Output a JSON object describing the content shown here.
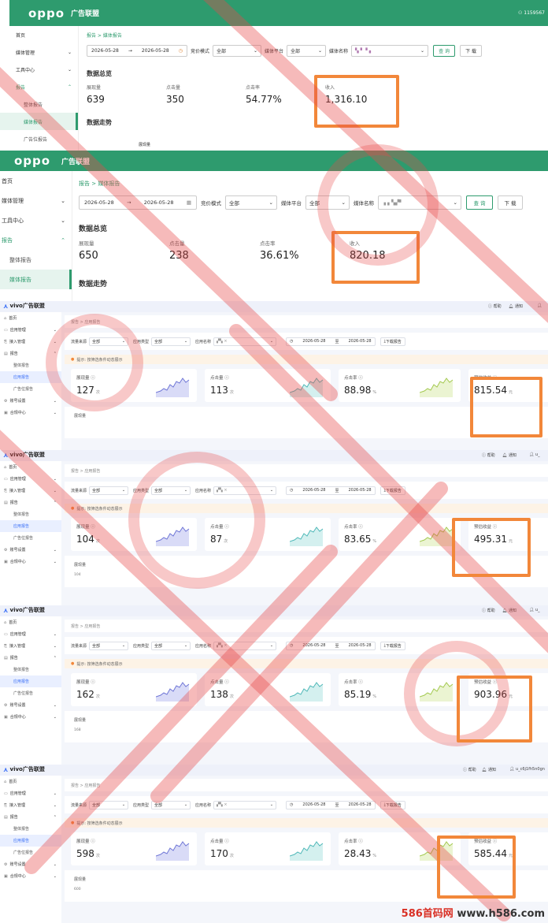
{
  "oppo_1": {
    "brand": "oppo",
    "brand_sub": "广告联盟",
    "user_id": "1159567",
    "sidebar": [
      {
        "label": "首页",
        "chevron": ""
      },
      {
        "label": "媒体管理",
        "chevron": "⌄"
      },
      {
        "label": "工具中心",
        "chevron": "⌄"
      },
      {
        "label": "报告",
        "chevron": "⌃"
      },
      {
        "label": "整体报告",
        "chevron": ""
      },
      {
        "label": "媒体报告",
        "chevron": ""
      },
      {
        "label": "广告位报告",
        "chevron": ""
      }
    ],
    "breadcrumb": "报告  >  媒体报告",
    "date_start": "2026-05-28",
    "date_end": "2026-05-28",
    "bid_mode_label": "竞价模式",
    "bid_mode_value": "全部",
    "platform_label": "媒体平台",
    "platform_value": "全部",
    "media_name_label": "媒体名称",
    "query_button": "查 询",
    "download_button": "下 载",
    "overview_title": "数据总览",
    "trend_title": "数据走势",
    "trend_sub": "展现量",
    "metrics": [
      {
        "label": "展现量",
        "value": "639"
      },
      {
        "label": "点击量",
        "value": "350"
      },
      {
        "label": "点击率",
        "value": "54.77%"
      },
      {
        "label": "收入",
        "value": "1,316.10"
      }
    ]
  },
  "oppo_2": {
    "brand": "oppo",
    "brand_sub": "广告联盟",
    "sidebar": [
      {
        "label": "首页",
        "chevron": ""
      },
      {
        "label": "媒体管理",
        "chevron": "⌄"
      },
      {
        "label": "工具中心",
        "chevron": "⌄"
      },
      {
        "label": "报告",
        "chevron": "⌃"
      },
      {
        "label": "整体报告",
        "chevron": ""
      },
      {
        "label": "媒体报告",
        "chevron": ""
      }
    ],
    "breadcrumb": "报告  >  媒体报告",
    "date_start": "2026-05-28",
    "date_end": "2026-05-28",
    "bid_mode_label": "竞价模式",
    "bid_mode_value": "全部",
    "platform_label": "媒体平台",
    "platform_value": "全部",
    "media_name_label": "媒体名称",
    "query_button": "查 询",
    "download_button": "下 载",
    "overview_title": "数据总览",
    "trend_title": "数据走势",
    "metrics": [
      {
        "label": "展现量",
        "value": "650"
      },
      {
        "label": "点击量",
        "value": "238"
      },
      {
        "label": "点击率",
        "value": "36.61%"
      },
      {
        "label": "收入",
        "value": "820.18"
      }
    ]
  },
  "vivo_common": {
    "brand": "vivo广告联盟",
    "help": "帮助",
    "notice": "通知",
    "sidebar": [
      {
        "icon": "⌂",
        "label": "首页",
        "chevron": "",
        "type": "top"
      },
      {
        "icon": "▭",
        "label": "应用管理",
        "chevron": "⌄",
        "type": "top"
      },
      {
        "icon": "⎘",
        "label": "接入管理",
        "chevron": "⌄",
        "type": "top"
      },
      {
        "icon": "▤",
        "label": "报告",
        "chevron": "⌃",
        "type": "top"
      },
      {
        "icon": "",
        "label": "整体报告",
        "chevron": "",
        "type": "sub"
      },
      {
        "icon": "",
        "label": "应用报告",
        "chevron": "",
        "type": "active"
      },
      {
        "icon": "",
        "label": "广告位报告",
        "chevron": "",
        "type": "sub"
      },
      {
        "icon": "⚙",
        "label": "账号设置",
        "chevron": "⌄",
        "type": "top"
      },
      {
        "icon": "▣",
        "label": "合规中心",
        "chevron": "⌄",
        "type": "top"
      }
    ],
    "breadcrumb": "报告  >  应用报告",
    "traffic_label": "流量来源",
    "app_type_label": "应用类型",
    "app_name_label": "应用名称",
    "select_all": "全部",
    "date_start": "2026-05-28",
    "date_sep": "至",
    "date_end": "2026-05-28",
    "download_report": "下载报告",
    "tip": "提示: 按筛选条件动态展示",
    "card_labels": [
      "展现量 ⓘ",
      "点击量 ⓘ",
      "点击率 ⓘ",
      "预估收益 ⓘ"
    ],
    "card_units": [
      "次",
      "次",
      "%",
      "元"
    ],
    "chart_label": "展现量"
  },
  "vivo_panels": [
    {
      "user": "",
      "values": [
        "127",
        "113",
        "88.98",
        "815.54"
      ],
      "chart_value": ""
    },
    {
      "user": "u_",
      "values": [
        "104",
        "87",
        "83.65",
        "495.31"
      ],
      "chart_value": "104"
    },
    {
      "user": "u_",
      "values": [
        "162",
        "138",
        "85.19",
        "903.96"
      ],
      "chart_value": "168"
    },
    {
      "user": "u_c6j1fh5n0gn",
      "values": [
        "598",
        "170",
        "28.43",
        "585.44"
      ],
      "chart_value": "600"
    }
  ],
  "watermark_site": {
    "brand": "586首码网",
    "url": "www.h586.com"
  },
  "colors": {
    "oppo_green": "#2e9b6e",
    "vivo_blue": "#3a6ff7",
    "highlight_orange": "#f2873a",
    "watermark_red": "#e84a4a"
  }
}
